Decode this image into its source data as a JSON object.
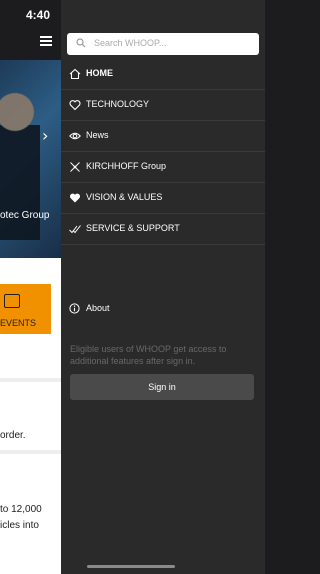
{
  "status": {
    "time": "4:40"
  },
  "background": {
    "hero_caption": "otec Group",
    "events_label": "EVENTS",
    "text1": "order.",
    "text2_line1": "to 12,000",
    "text2_line2": "icles into"
  },
  "search": {
    "placeholder": "Search WHOOP..."
  },
  "menu": [
    {
      "label": "HOME",
      "icon": "home-icon"
    },
    {
      "label": "TECHNOLOGY",
      "icon": "heart-outline-icon"
    },
    {
      "label": "News",
      "icon": "eye-icon"
    },
    {
      "label": "KIRCHHOFF Group",
      "icon": "network-icon"
    },
    {
      "label": "VISION & VALUES",
      "icon": "heart-filled-icon"
    },
    {
      "label": "SERVICE & SUPPORT",
      "icon": "double-check-icon"
    }
  ],
  "about": {
    "label": "About"
  },
  "eligible_text": "Eligible users of WHOOP get access to additional features after sign in.",
  "signin_label": "Sign in",
  "colors": {
    "drawer": "#2a2a2a",
    "accent": "#f29100",
    "muted": "#686868"
  }
}
